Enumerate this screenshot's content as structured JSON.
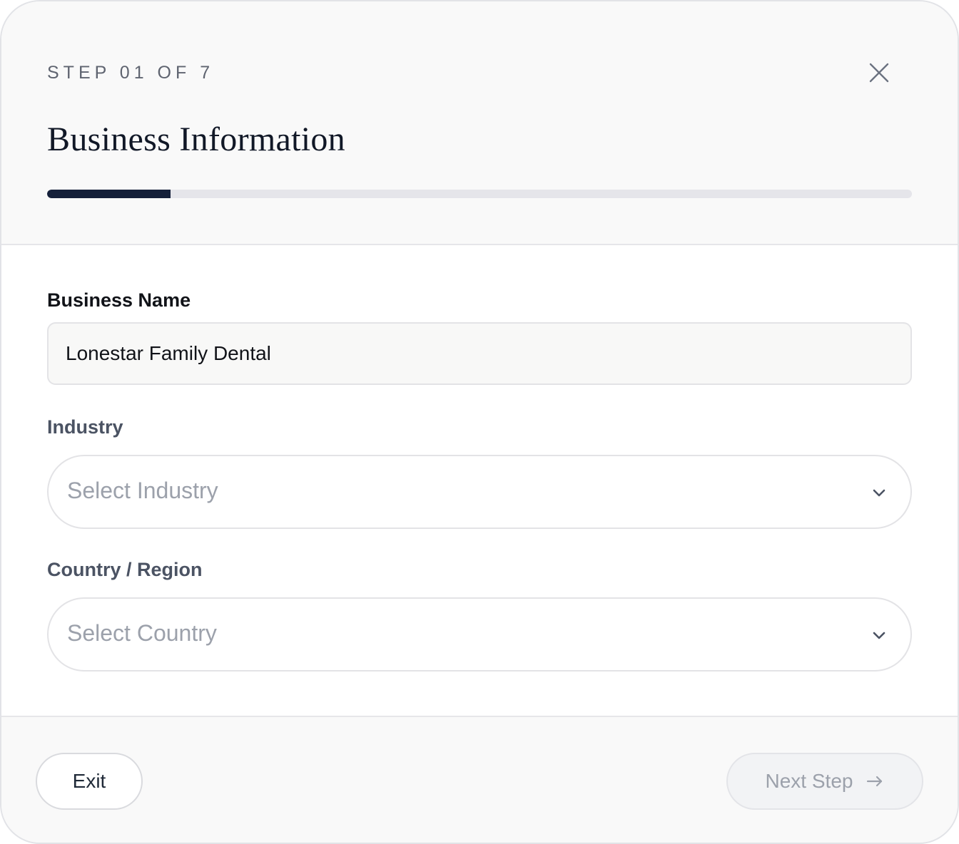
{
  "header": {
    "step_label": "STEP 01 OF 7",
    "title": "Business Information",
    "progress": {
      "current": 1,
      "total": 7,
      "fraction": 0.143
    }
  },
  "icons": {
    "close": "close-icon",
    "chevron": "chevron-down-icon",
    "arrow": "arrow-right-icon"
  },
  "form": {
    "business_name": {
      "label": "Business Name",
      "value": "Lonestar Family Dental"
    },
    "industry": {
      "label": "Industry",
      "placeholder": "Select Industry"
    },
    "country": {
      "label": "Country / Region",
      "placeholder": "Select Country"
    }
  },
  "footer": {
    "exit_label": "Exit",
    "next_label": "Next Step"
  },
  "colors": {
    "progress_fill": "#15203a",
    "progress_track": "#e5e5ea",
    "placeholder": "#9ca1ab"
  }
}
